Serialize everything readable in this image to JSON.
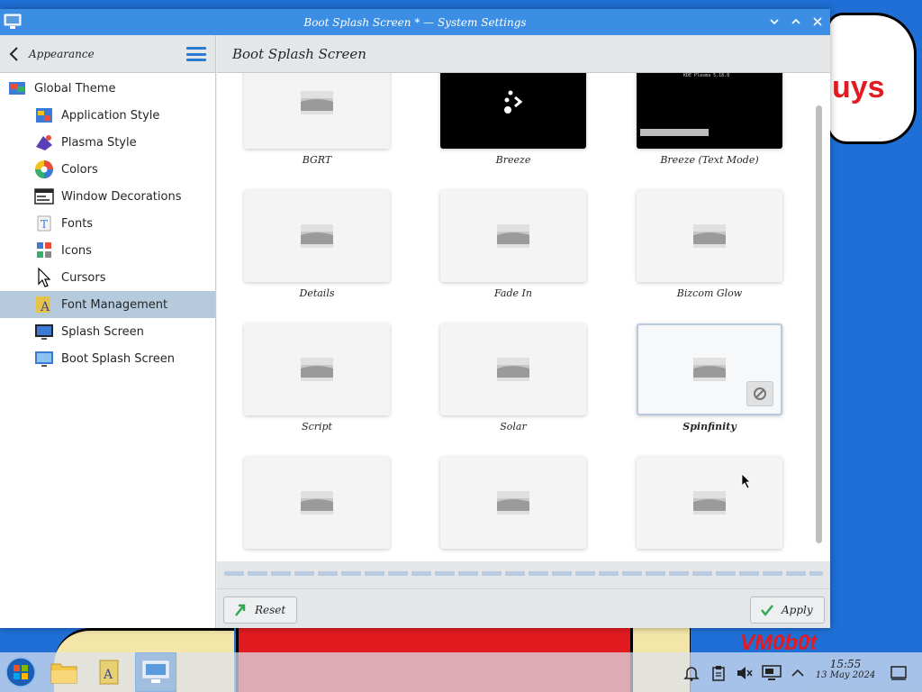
{
  "window": {
    "title": "Boot Splash Screen * — System Settings"
  },
  "sidebar": {
    "header_label": "Appearance",
    "items": [
      {
        "label": "Global Theme"
      },
      {
        "label": "Application Style"
      },
      {
        "label": "Plasma Style"
      },
      {
        "label": "Colors"
      },
      {
        "label": "Window Decorations"
      },
      {
        "label": "Fonts"
      },
      {
        "label": "Icons"
      },
      {
        "label": "Cursors"
      },
      {
        "label": "Font Management"
      },
      {
        "label": "Splash Screen"
      },
      {
        "label": "Boot Splash Screen"
      }
    ],
    "selected": "Font Management"
  },
  "main": {
    "page_title": "Boot Splash Screen",
    "themes": [
      {
        "label": "BGRT"
      },
      {
        "label": "Breeze"
      },
      {
        "label": "Breeze (Text Mode)"
      },
      {
        "label": "Details"
      },
      {
        "label": "Fade In"
      },
      {
        "label": "Bizcom Glow"
      },
      {
        "label": "Script"
      },
      {
        "label": "Solar"
      },
      {
        "label": "Spinfinity"
      },
      {
        "label": ""
      },
      {
        "label": ""
      },
      {
        "label": ""
      }
    ],
    "selected_theme": "Spinfinity",
    "text_mode_preview": "KDE Plasma 5.18.8"
  },
  "footer": {
    "reset_label": "Reset",
    "apply_label": "Apply"
  },
  "wallpaper": {
    "bubble_text": "uys",
    "logo_text": "VM0b0t"
  },
  "taskbar": {
    "time": "15:55",
    "date": "13 May 2024"
  },
  "colors": {
    "titlebar": "#3b8ee3",
    "selection": "#b6cadd",
    "accent": "#2d7bd0"
  }
}
